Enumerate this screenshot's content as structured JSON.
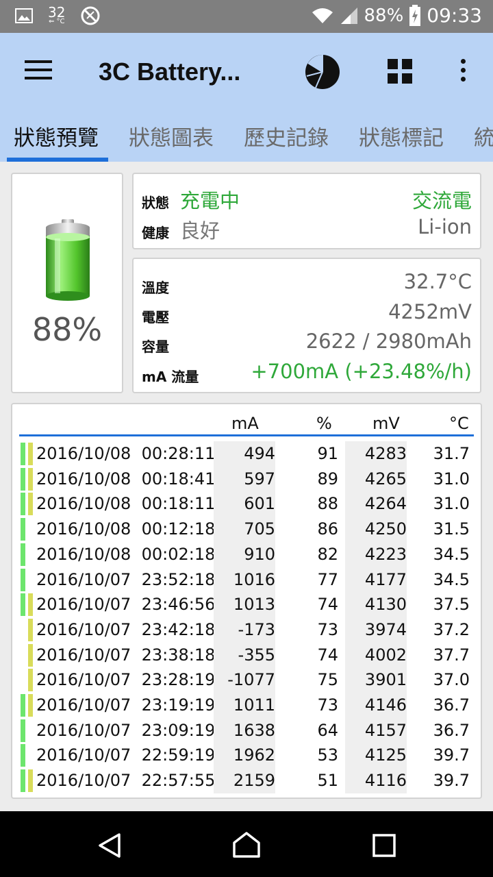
{
  "status_bar": {
    "temp": "32",
    "temp_unit": "°C",
    "battery_pct": "88%",
    "time": "09:33"
  },
  "app_bar": {
    "title": "3C Battery...",
    "tabs": [
      "狀態預覽",
      "狀態圖表",
      "歷史記錄",
      "狀態標記",
      "統"
    ]
  },
  "battery": {
    "percent": "88%"
  },
  "status": {
    "status_label": "狀態",
    "status_value": "充電中",
    "power_source": "交流電",
    "health_label": "健康",
    "health_value": "良好",
    "chemistry": "Li-ion"
  },
  "info": {
    "temperature_label": "溫度",
    "temperature_value": "32.7°C",
    "voltage_label": "電壓",
    "voltage_value": "4252mV",
    "capacity_label": "容量",
    "capacity_value": "2622 / 2980mAh",
    "flow_label": "mA 流量",
    "flow_value": "+700mA (+23.48%/h)"
  },
  "table": {
    "headers": {
      "ma": "mA",
      "pct": "%",
      "mv": "mV",
      "temp": "°C"
    },
    "rows": [
      {
        "datetime": "2016/10/08  00:28:11",
        "ma": "494",
        "pct": "91",
        "mv": "4283",
        "temp": "31.7",
        "marks": [
          "green",
          "yellow"
        ]
      },
      {
        "datetime": "2016/10/08  00:18:41",
        "ma": "597",
        "pct": "89",
        "mv": "4265",
        "temp": "31.0",
        "marks": [
          "green",
          "yellow"
        ]
      },
      {
        "datetime": "2016/10/08  00:18:11",
        "ma": "601",
        "pct": "88",
        "mv": "4264",
        "temp": "31.0",
        "marks": [
          "green",
          "yellow"
        ]
      },
      {
        "datetime": "2016/10/08  00:12:18",
        "ma": "705",
        "pct": "86",
        "mv": "4250",
        "temp": "31.5",
        "marks": [
          "green"
        ]
      },
      {
        "datetime": "2016/10/08  00:02:18",
        "ma": "910",
        "pct": "82",
        "mv": "4223",
        "temp": "34.5",
        "marks": [
          "green"
        ]
      },
      {
        "datetime": "2016/10/07  23:52:18",
        "ma": "1016",
        "pct": "77",
        "mv": "4177",
        "temp": "34.5",
        "marks": [
          "green"
        ]
      },
      {
        "datetime": "2016/10/07  23:46:56",
        "ma": "1013",
        "pct": "74",
        "mv": "4130",
        "temp": "37.5",
        "marks": [
          "green",
          "yellow"
        ]
      },
      {
        "datetime": "2016/10/07  23:42:18",
        "ma": "-173",
        "pct": "73",
        "mv": "3974",
        "temp": "37.2",
        "marks": [
          "yellow"
        ]
      },
      {
        "datetime": "2016/10/07  23:38:18",
        "ma": "-355",
        "pct": "74",
        "mv": "4002",
        "temp": "37.7",
        "marks": [
          "yellow"
        ]
      },
      {
        "datetime": "2016/10/07  23:28:19",
        "ma": "-1077",
        "pct": "75",
        "mv": "3901",
        "temp": "37.0",
        "marks": [
          "yellow"
        ]
      },
      {
        "datetime": "2016/10/07  23:19:19",
        "ma": "1011",
        "pct": "73",
        "mv": "4146",
        "temp": "36.7",
        "marks": [
          "green",
          "yellow"
        ]
      },
      {
        "datetime": "2016/10/07  23:09:19",
        "ma": "1638",
        "pct": "64",
        "mv": "4157",
        "temp": "36.7",
        "marks": [
          "green"
        ]
      },
      {
        "datetime": "2016/10/07  22:59:19",
        "ma": "1962",
        "pct": "53",
        "mv": "4125",
        "temp": "39.7",
        "marks": [
          "green"
        ]
      },
      {
        "datetime": "2016/10/07  22:57:55",
        "ma": "2159",
        "pct": "51",
        "mv": "4116",
        "temp": "39.7",
        "marks": [
          "green",
          "yellow"
        ]
      }
    ]
  },
  "colors": {
    "app_bar": "#b9d3f5",
    "accent": "#1e6fd9",
    "charging_green": "#2fa83a",
    "mark_green": "#6de56d",
    "mark_yellow": "#d9dc5a"
  },
  "icons": [
    "gallery-icon",
    "usb-icon",
    "no-data-icon",
    "wifi-icon",
    "signal-icon",
    "battery-charging-icon",
    "menu-icon",
    "pie-chart-icon",
    "grid-icon",
    "more-vert-icon",
    "back-icon",
    "home-icon",
    "recents-icon"
  ]
}
